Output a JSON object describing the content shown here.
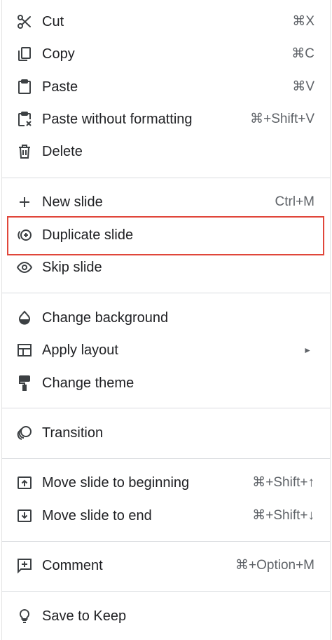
{
  "menu": {
    "items": [
      {
        "name": "cut",
        "icon": "scissors-icon",
        "label": "Cut",
        "shortcut": "⌘X"
      },
      {
        "name": "copy",
        "icon": "copy-icon",
        "label": "Copy",
        "shortcut": "⌘C"
      },
      {
        "name": "paste",
        "icon": "clipboard-icon",
        "label": "Paste",
        "shortcut": "⌘V"
      },
      {
        "name": "paste-without-formatting",
        "icon": "clipboard-clear-format-icon",
        "label": "Paste without formatting",
        "shortcut": "⌘+Shift+V"
      },
      {
        "name": "delete",
        "icon": "trash-icon",
        "label": "Delete",
        "shortcut": ""
      },
      {
        "name": "new-slide",
        "icon": "plus-icon",
        "label": "New slide",
        "shortcut": "Ctrl+M"
      },
      {
        "name": "duplicate-slide",
        "icon": "duplicate-icon",
        "label": "Duplicate slide",
        "shortcut": ""
      },
      {
        "name": "skip-slide",
        "icon": "eye-icon",
        "label": "Skip slide",
        "shortcut": ""
      },
      {
        "name": "change-background",
        "icon": "paint-drop-icon",
        "label": "Change background",
        "shortcut": ""
      },
      {
        "name": "apply-layout",
        "icon": "layout-icon",
        "label": "Apply layout",
        "shortcut": "",
        "submenu": true
      },
      {
        "name": "change-theme",
        "icon": "paint-roller-icon",
        "label": "Change theme",
        "shortcut": ""
      },
      {
        "name": "transition",
        "icon": "transition-icon",
        "label": "Transition",
        "shortcut": ""
      },
      {
        "name": "move-slide-to-beginning",
        "icon": "move-up-box-icon",
        "label": "Move slide to beginning",
        "shortcut": "⌘+Shift+↑"
      },
      {
        "name": "move-slide-to-end",
        "icon": "move-down-box-icon",
        "label": "Move slide to end",
        "shortcut": "⌘+Shift+↓"
      },
      {
        "name": "comment",
        "icon": "comment-add-icon",
        "label": "Comment",
        "shortcut": "⌘+Option+M"
      },
      {
        "name": "save-to-keep",
        "icon": "lightbulb-icon",
        "label": "Save to Keep",
        "shortcut": ""
      }
    ],
    "submenu_arrow": "►"
  },
  "colors": {
    "text": "#202124",
    "shortcut_text": "#5f6368",
    "icon": "#3c4043",
    "separator": "#dadce0",
    "highlight_border": "#e0463a"
  }
}
